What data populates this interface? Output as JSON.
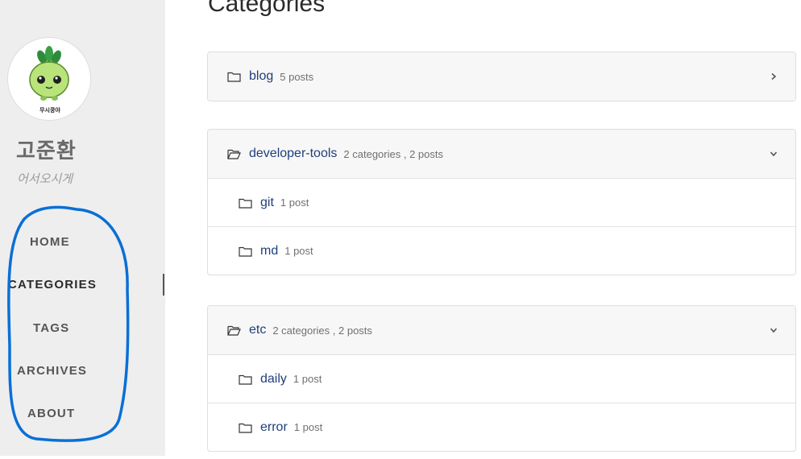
{
  "sidebar": {
    "avatar_caption": "무시쿵야",
    "title": "고준환",
    "subtitle": "어서오시게",
    "nav": [
      {
        "label": "HOME"
      },
      {
        "label": "CATEGORIES"
      },
      {
        "label": "TAGS"
      },
      {
        "label": "ARCHIVES"
      },
      {
        "label": "ABOUT"
      }
    ],
    "annotation_color": "#0a6fd6"
  },
  "main": {
    "page_title": "Categories",
    "groups": [
      {
        "name": "blog",
        "meta": "5 posts",
        "icon": "folder-icon",
        "chevron": "chevron-right-icon",
        "children": []
      },
      {
        "name": "developer-tools",
        "meta": "2 categories , 2 posts",
        "icon": "folder-open-icon",
        "chevron": "chevron-down-icon",
        "children": [
          {
            "name": "git",
            "meta": "1 post"
          },
          {
            "name": "md",
            "meta": "1 post"
          }
        ]
      },
      {
        "name": "etc",
        "meta": "2 categories , 2 posts",
        "icon": "folder-open-icon",
        "chevron": "chevron-down-icon",
        "children": [
          {
            "name": "daily",
            "meta": "1 post"
          },
          {
            "name": "error",
            "meta": "1 post"
          }
        ]
      }
    ],
    "link_color": "#1f3f7a"
  }
}
